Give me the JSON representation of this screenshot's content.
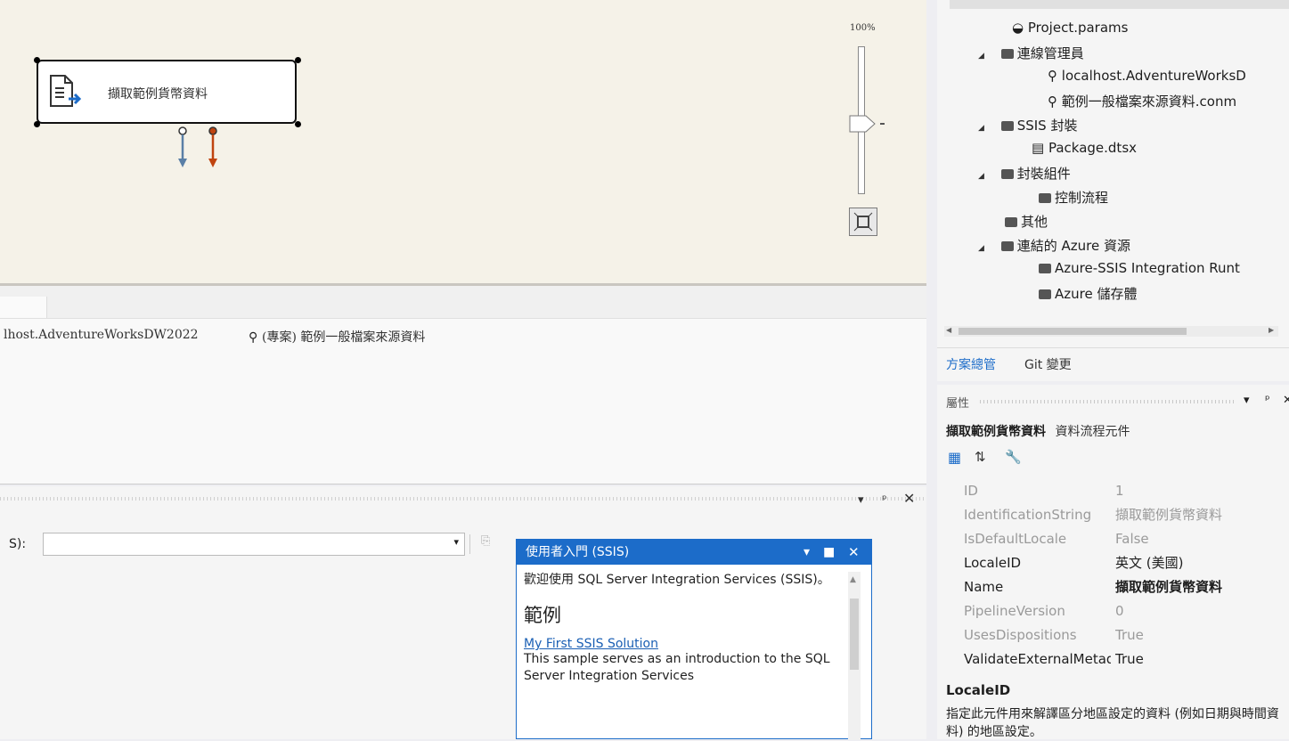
{
  "designer": {
    "task_label": "擷取範例貨幣資料",
    "zoom_label": "100%"
  },
  "connection_managers": {
    "item1": "lhost.AdventureWorksDW2022",
    "item2": "(專案) 範例一般檔案來源資料"
  },
  "output": {
    "label": "S):",
    "pin": "⊕",
    "close": "✕"
  },
  "getting_started": {
    "title": "使用者入門 (SSIS)",
    "welcome": "歡迎使用 SQL Server Integration Services (SSIS)。",
    "heading": "範例",
    "link": "My First SSIS Solution",
    "desc": "This sample serves as an introduction to the SQL Server Integration Services"
  },
  "solution_explorer": {
    "items": [
      "Project.params",
      "連線管理員",
      "localhost.AdventureWorksD",
      "範例一般檔案來源資料.conm",
      "SSIS 封裝",
      "Package.dtsx",
      "封裝組件",
      "控制流程",
      "其他",
      "連結的 Azure 資源",
      "Azure-SSIS Integration Runt",
      "Azure 儲存體"
    ],
    "tab_active": "方案總管",
    "tab_git": "Git 變更"
  },
  "properties": {
    "title": "屬性",
    "object_name": "擷取範例貨幣資料",
    "object_type": "資料流程元件",
    "rows": [
      {
        "name": "ID",
        "value": "1"
      },
      {
        "name": "IdentificationString",
        "value": "擷取範例貨幣資料"
      },
      {
        "name": "IsDefaultLocale",
        "value": "False"
      },
      {
        "name": "LocaleID",
        "value": "英文 (美國)"
      },
      {
        "name": "Name",
        "value": "擷取範例貨幣資料"
      },
      {
        "name": "PipelineVersion",
        "value": "0"
      },
      {
        "name": "UsesDispositions",
        "value": "True"
      },
      {
        "name": "ValidateExternalMetadata",
        "value": "True"
      }
    ],
    "desc_title": "LocaleID",
    "desc_text": "指定此元件用來解譯區分地區設定的資料 (例如日期與時間資料) 的地區設定。"
  },
  "colors": {
    "accent": "#1c6cc9",
    "arrow_blue": "#5a7fa6",
    "arrow_red": "#c0440f",
    "canvas_bg": "#f5f2e8"
  }
}
